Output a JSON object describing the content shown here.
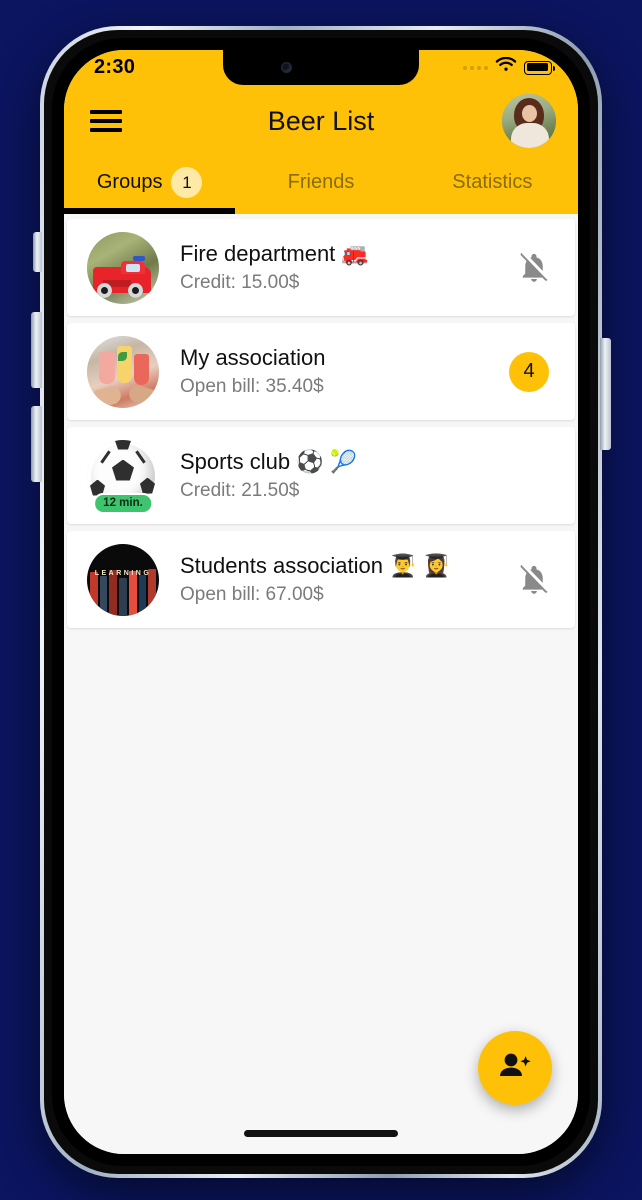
{
  "status_bar": {
    "time": "2:30",
    "signal_icon": "signal-dots-icon",
    "wifi_icon": "wifi-icon",
    "battery_icon": "battery-full-icon"
  },
  "header": {
    "menu_icon": "hamburger-menu-icon",
    "title": "Beer List",
    "avatar_icon": "user-avatar-photo"
  },
  "tabs": [
    {
      "label": "Groups",
      "badge": "1",
      "active": true
    },
    {
      "label": "Friends",
      "badge": null,
      "active": false
    },
    {
      "label": "Statistics",
      "badge": null,
      "active": false
    }
  ],
  "groups": [
    {
      "name": "Fire department 🚒",
      "subtitle": "Credit: 15.00$",
      "avatar": "fire-truck-photo",
      "right_indicator": "bell-off-icon",
      "badge_count": null,
      "time_badge": null
    },
    {
      "name": "My association",
      "subtitle": "Open bill: 35.40$",
      "avatar": "cheers-drinks-photo",
      "right_indicator": "count-badge",
      "badge_count": "4",
      "time_badge": null
    },
    {
      "name": "Sports club ⚽ 🎾",
      "subtitle": "Credit: 21.50$",
      "avatar": "soccer-ball-photo",
      "right_indicator": null,
      "badge_count": null,
      "time_badge": "12 min."
    },
    {
      "name": "Students association 👨‍🎓 👩‍🎓",
      "subtitle": "Open bill: 67.00$",
      "avatar": "books-shelf-photo",
      "right_indicator": "bell-off-icon",
      "badge_count": null,
      "time_badge": null
    }
  ],
  "fab": {
    "icon": "person-add-icon"
  },
  "colors": {
    "accent_yellow": "#FFC107",
    "page_background": "#0b1560",
    "list_background": "#f7f7f7",
    "card_white": "#ffffff",
    "subtitle_gray": "#7b7b7b",
    "badge_green": "#3ec46d",
    "tab_inactive": "#8a6d08"
  }
}
